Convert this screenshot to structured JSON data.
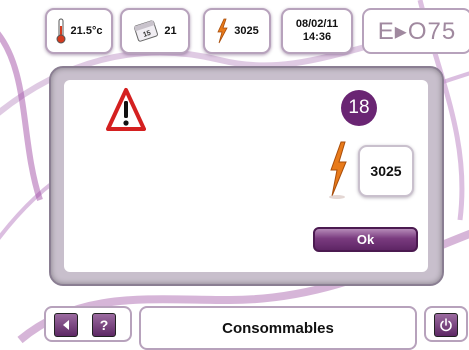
{
  "status_bar": {
    "temperature": "21.5°c",
    "calendar_day": "21",
    "energy": "3025",
    "date": "08/02/11",
    "time": "14:36",
    "logo": "E▸O75"
  },
  "dialog": {
    "badge_number": "18",
    "value": "3025",
    "ok_label": "Ok"
  },
  "bottom_bar": {
    "help_label": "?",
    "title": "Consommables"
  },
  "colors": {
    "accent_purple": "#6a2573",
    "frame_border": "#b7a2bc",
    "warning_red": "#d42020",
    "lightning_orange": "#e87a1a"
  }
}
